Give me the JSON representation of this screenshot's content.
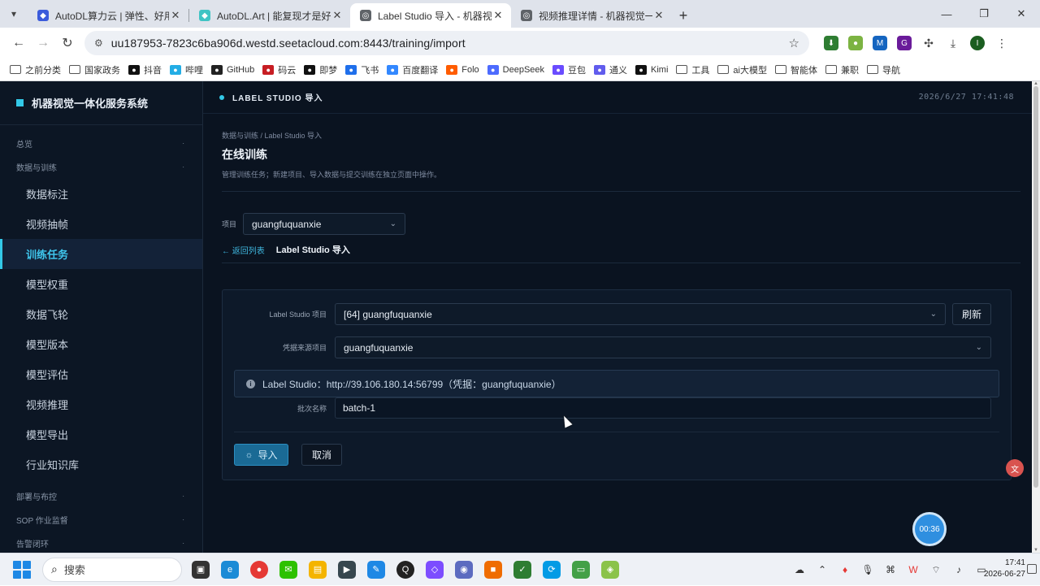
{
  "browser": {
    "tabs": [
      {
        "label": "AutoDL算力云 | 弹性、好用、省钱",
        "favicon_color": "#3b5bdb"
      },
      {
        "label": "AutoDL.Art | 能复现才是好算法",
        "favicon_color": "#40c4c4"
      },
      {
        "label": "Label Studio 导入 - 机器视觉一体化",
        "favicon_color": "#5f6368"
      },
      {
        "label": "视频推理详情 - 机器视觉一体化",
        "favicon_color": "#5f6368"
      }
    ],
    "url": "uu187953-7823c6ba906d.westd.seetacloud.com:8443/training/import",
    "bookmarks": [
      {
        "label": "之前分类",
        "icon": "folder-icon"
      },
      {
        "label": "国家政务",
        "icon": "folder-icon"
      },
      {
        "label": "抖音",
        "icon": "douyin-icon",
        "color": "#111111"
      },
      {
        "label": "哔哩",
        "icon": "bilibili-icon",
        "color": "#23ade5"
      },
      {
        "label": "GitHub",
        "icon": "github-icon",
        "color": "#222222"
      },
      {
        "label": "码云",
        "icon": "gitee-icon",
        "color": "#c71d23"
      },
      {
        "label": "即梦",
        "icon": "jimeng-icon",
        "color": "#111111"
      },
      {
        "label": "飞书",
        "icon": "feishu-icon",
        "color": "#1f6feb"
      },
      {
        "label": "百度翻译",
        "icon": "baidu-translate-icon",
        "color": "#3388ff"
      },
      {
        "label": "Folo",
        "icon": "folo-icon",
        "color": "#ff5c00"
      },
      {
        "label": "DeepSeek",
        "icon": "deepseek-icon",
        "color": "#4d6bfe"
      },
      {
        "label": "豆包",
        "icon": "doubao-icon",
        "color": "#6a4cff"
      },
      {
        "label": "通义",
        "icon": "tongyi-icon",
        "color": "#615ced"
      },
      {
        "label": "Kimi",
        "icon": "kimi-icon",
        "color": "#111111"
      },
      {
        "label": "工具",
        "icon": "folder-icon"
      },
      {
        "label": "ai大模型",
        "icon": "folder-icon"
      },
      {
        "label": "智能体",
        "icon": "folder-icon"
      },
      {
        "label": "兼职",
        "icon": "folder-icon"
      },
      {
        "label": "导航",
        "icon": "folder-icon"
      }
    ]
  },
  "app": {
    "brand": "机器视觉一体化服务系统",
    "accent": "#33c9e8",
    "sidebar": {
      "groups_top": [
        {
          "label": "总览"
        },
        {
          "label": "数据与训练"
        }
      ],
      "items": [
        {
          "label": "数据标注",
          "active": false
        },
        {
          "label": "视频抽帧",
          "active": false
        },
        {
          "label": "训练任务",
          "active": true
        },
        {
          "label": "模型权重",
          "active": false
        },
        {
          "label": "数据飞轮",
          "active": false
        },
        {
          "label": "模型版本",
          "active": false
        },
        {
          "label": "模型评估",
          "active": false
        },
        {
          "label": "视频推理",
          "active": false
        },
        {
          "label": "模型导出",
          "active": false
        },
        {
          "label": "行业知识库",
          "active": false
        }
      ],
      "groups_bottom": [
        {
          "label": "部署与布控"
        },
        {
          "label": "SOP 作业监督"
        },
        {
          "label": "告警闭环"
        }
      ]
    },
    "header": {
      "title": "LABEL STUDIO 导入",
      "datetime": "2026/6/27 17:41:48"
    },
    "page": {
      "breadcrumb": "数据与训练 / Label Studio 导入",
      "title": "在线训练",
      "subtitle": "管理训练任务；新建项目、导入数据与提交训练在独立页面中操作。",
      "project_label": "项目",
      "project_value": "guangfuquanxie",
      "back_link": "← 返回列表",
      "current_view": "Label Studio 导入"
    },
    "form": {
      "ls_project_label": "Label Studio 项目",
      "ls_project_value": "[64] guangfuquanxie",
      "refresh_label": "刷新",
      "credential_label": "凭据来源项目",
      "credential_value": "guangfuquanxie",
      "info_text": "Label Studio：http://39.106.180.14:56799（凭据：guangfuquanxie）",
      "batch_label": "批次名称",
      "batch_value": "batch-1",
      "import_label": "导入",
      "cancel_label": "取消"
    },
    "timer": "00:36"
  },
  "taskbar": {
    "search_placeholder": "搜索",
    "time": "17:41",
    "date": "2026-06-27"
  }
}
